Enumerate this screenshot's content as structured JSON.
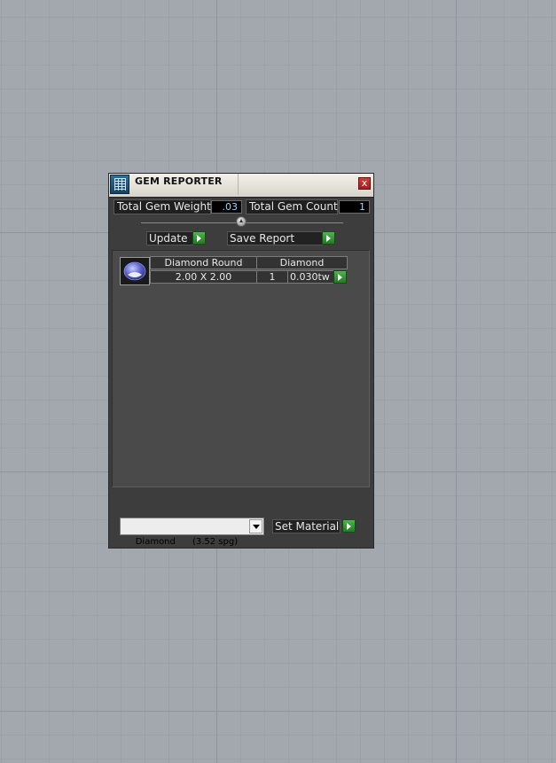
{
  "window": {
    "title": "GEM REPORTER",
    "close_label": "x",
    "icon": "report-grid-icon"
  },
  "stats": {
    "total_weight_label": "Total Gem Weight",
    "total_weight_value": ".03",
    "total_count_label": "Total Gem Count",
    "total_count_value": "1"
  },
  "toolbar": {
    "update_label": "Update",
    "save_report_label": "Save Report"
  },
  "gem_list": [
    {
      "icon": "round-gem-icon",
      "shape": "Diamond Round",
      "material": "Diamond",
      "size": "2.00 X 2.00",
      "count": "1",
      "weight": "0.030tw"
    }
  ],
  "material": {
    "selected": "Diamond      (3.52 spg)",
    "set_material_label": "Set Material"
  },
  "colors": {
    "panel_bg": "#3d3d3d",
    "list_bg": "#4a4a4a",
    "accent_green": "#3a9a3a",
    "value_text": "#8fd6ff",
    "close_red": "#c02a2a"
  }
}
